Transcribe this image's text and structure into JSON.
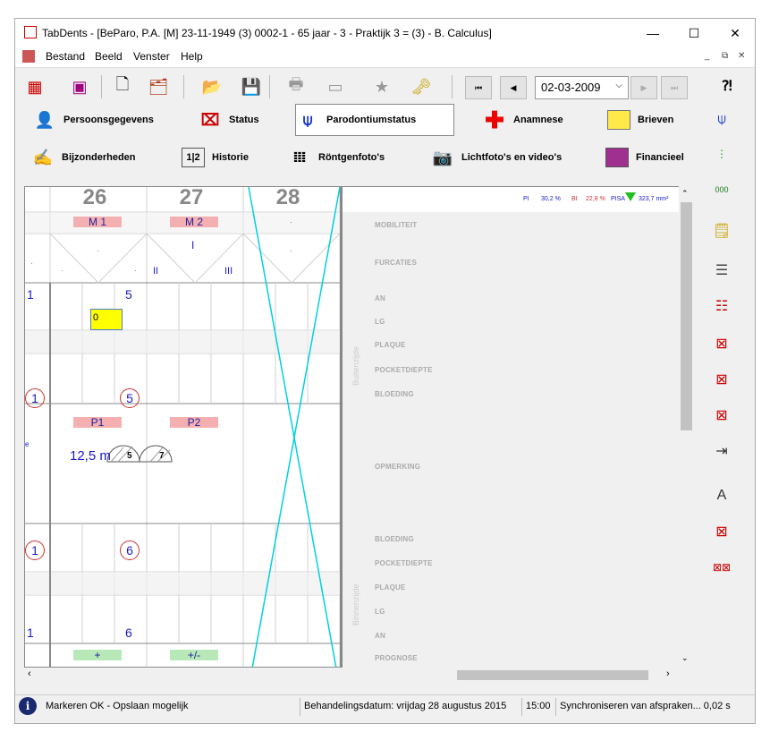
{
  "window": {
    "title": "TabDents - [BeParo, P.A. [M] 23-11-1949 (3) 0002-1 - 65 jaar - 3 - Praktijk 3 = (3) - B. Calculus]",
    "minimize": "—",
    "maximize": "☐",
    "close": "✕"
  },
  "menu": [
    "Bestand",
    "Beeld",
    "Venster",
    "Help"
  ],
  "toolbar": {
    "date": "02-03-2009",
    "help_glyph": "⁈"
  },
  "tabs": {
    "row1": [
      "Persoonsgegevens",
      "Status",
      "Parodontiumstatus",
      "Anamnese",
      "Brieven"
    ],
    "row2": [
      "Bijzonderheden",
      "Historie",
      "Röntgenfoto's",
      "Lichtfoto's en video's",
      "Financieel"
    ]
  },
  "grid": {
    "teeth": [
      "26",
      "27",
      "28"
    ],
    "top_labels": [
      "M 1",
      "M 2"
    ],
    "furcation": {
      "I": "I",
      "II": "II",
      "III": "III"
    },
    "an_top": [
      "1",
      "5"
    ],
    "input_value": "0",
    "bleeding_top": [
      "1",
      "5"
    ],
    "palatal_labels": [
      "P1",
      "P2"
    ],
    "measure": "12,5 m",
    "implant_nums": [
      "5",
      "7"
    ],
    "bleeding_bottom": [
      "1",
      "6"
    ],
    "an_bottom": [
      "1",
      "6"
    ],
    "prognosis": [
      "+",
      "+/-"
    ],
    "dot": "·",
    "edge_glyph": "ᵉ"
  },
  "panel": {
    "stats": {
      "pi_label": "PI",
      "pi_value": "30,2 %",
      "bi_label": "BI",
      "bi_value": "22,8 %",
      "pisa_label": "PISA",
      "pisa_value": "323,7 mm²"
    },
    "labels_top": [
      "MOBILITEIT",
      "FURCATIES",
      "AN",
      "LG",
      "PLAQUE",
      "POCKETDIEPTE",
      "BLOEDING",
      "OPMERKING"
    ],
    "labels_bottom": [
      "BLOEDING",
      "POCKETDIEPTE",
      "PLAQUE",
      "LG",
      "AN",
      "PROGNOSE"
    ],
    "side_top": "Buitenzijde",
    "side_bottom": "Binnenzijde"
  },
  "status": {
    "message": "Markeren OK - Opslaan mogelijk",
    "treatment_date": "Behandelingsdatum: vrijdag 28 augustus 2015",
    "time": "15:00",
    "sync": "Synchroniseren van afspraken... 0,02 s"
  },
  "colors": {
    "accent_blue": "#1a1ac8",
    "pink_label": "#f4b0b0",
    "green_label": "#b8e8b8",
    "cyan_cross": "#00d0e0",
    "pisa_green": "#20c020"
  }
}
